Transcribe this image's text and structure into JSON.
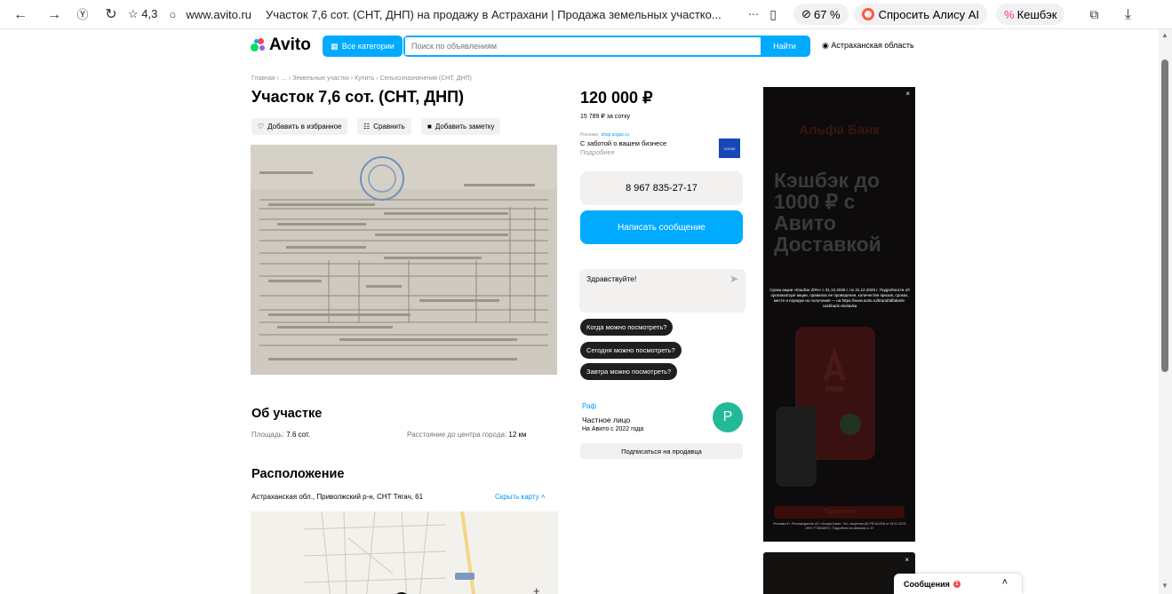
{
  "browser": {
    "rating": "☆ 4,3",
    "url": "www.avito.ru",
    "tab_title": "Участок 7,6 сот. (СНТ, ДНП) на продажу в Астрахани | Продажа земельных участко...",
    "zoom": "67 %",
    "alice": "Спросить Алису AI",
    "cashback": "Кешбэк"
  },
  "header": {
    "logo": "Avito",
    "categories": "Все категории",
    "search_placeholder": "Поиск по объявлениям",
    "search_button": "Найти",
    "region": "Астраханская область"
  },
  "listing": {
    "breadcrumb": "Главная › … › Земельные участки › Купить › Сельхозназначения (СНТ, ДНП)",
    "title": "Участок 7,6 сот. (СНТ, ДНП)",
    "actions": {
      "favorite": "Добавить в избранное",
      "compare": "Сравнить",
      "note": "Добавить заметку"
    },
    "price": "120 000 ₽",
    "price_per_unit": "15 789 ₽ за сотку",
    "about_title": "Об участке",
    "params": [
      {
        "label": "Площадь:",
        "value": "7.6 сот."
      },
      {
        "label": "Расстояние до центра города:",
        "value": "12 км"
      }
    ],
    "location_title": "Расположение",
    "address": "Астраханская обл., Приволжский р-н, СНТ Тягач, 61",
    "hide_map": "Скрыть карту"
  },
  "ad": {
    "label": "Реклама",
    "domain": "shop.sogaz.ru",
    "text": "С заботой о вашем бизнесе",
    "more": "Подробнее",
    "logo": "СОГАЗ"
  },
  "contact": {
    "phone": "8 967 835-27-17",
    "message_button": "Написать сообщение",
    "chat_placeholder": "Здравствуйте!",
    "quick_questions": [
      "Когда можно посмотреть?",
      "Сегодня можно посмотреть?",
      "Завтра можно посмотреть?"
    ]
  },
  "seller": {
    "name": "Раф",
    "type": "Частное лицо",
    "since": "На Авито с 2022 года",
    "avatar_letter": "Р",
    "subscribe": "Подписаться на продавца"
  },
  "banner": {
    "brand": "Альфа Банк",
    "headline": "Кэшбэк до 1000 ₽ с Авито Доставкой",
    "terms": "Сроки акции «Кэшбэк 20%» с 01.12.2025 г. по 31.12.2025 г. Подробности об организаторе акции, правилах ее проведения, количестве призов, сроках, месте и порядке их получения — на https://www.avito.ru/brand/alfabank-cashback-dostavka",
    "button": "Подробнее",
    "legal": "Реклама 6+. Рекламодатель АО «Альфа-Банк». Ген. лицензия ЦБ РФ №1326 от 16.01.2015. ИНН 7728168971. Подробнее на alfabank.ru. 6+"
  },
  "messages": {
    "label": "Сообщения",
    "count": "1"
  },
  "colors": {
    "accent": "#00aaff",
    "avatar": "#22b999",
    "badge": "#ff4053"
  }
}
